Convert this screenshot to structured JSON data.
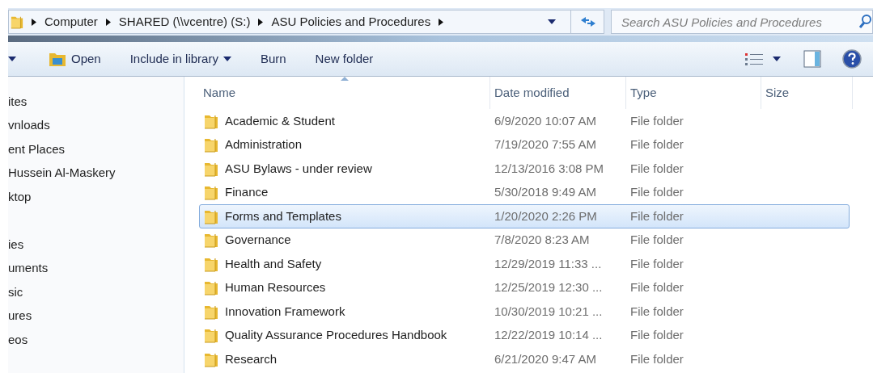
{
  "address_bar": {
    "segments": [
      "Computer",
      "SHARED (\\\\vcentre) (S:)",
      "ASU Policies and Procedures"
    ]
  },
  "search": {
    "placeholder": "Search ASU Policies and Procedures"
  },
  "toolbar": {
    "buttons": [
      {
        "label": "Open",
        "kind": "open"
      },
      {
        "label": "Include in library",
        "kind": "dropdown"
      },
      {
        "label": "Burn",
        "kind": "plain"
      },
      {
        "label": "New folder",
        "kind": "plain"
      }
    ]
  },
  "sidebar": {
    "groups": [
      {
        "items": [
          "ites",
          "vnloads",
          "ent Places",
          "Hussein Al-Maskery",
          "ktop"
        ]
      },
      {
        "items": [
          "ies",
          "uments",
          "sic",
          "ures",
          "eos"
        ]
      }
    ]
  },
  "table": {
    "columns": [
      {
        "label": "Name",
        "sorted": true
      },
      {
        "label": "Date modified",
        "sorted": false
      },
      {
        "label": "Type",
        "sorted": false
      },
      {
        "label": "Size",
        "sorted": false
      }
    ],
    "rows": [
      {
        "name": "Academic & Student",
        "date": "6/9/2020 10:07 AM",
        "type": "File folder",
        "selected": false
      },
      {
        "name": "Administration",
        "date": "7/19/2020 7:55 AM",
        "type": "File folder",
        "selected": false
      },
      {
        "name": "ASU Bylaws - under review",
        "date": "12/13/2016 3:08 PM",
        "type": "File folder",
        "selected": false
      },
      {
        "name": "Finance",
        "date": "5/30/2018 9:49 AM",
        "type": "File folder",
        "selected": false
      },
      {
        "name": "Forms and Templates",
        "date": "1/20/2020 2:26 PM",
        "type": "File folder",
        "selected": true
      },
      {
        "name": "Governance",
        "date": "7/8/2020 8:23 AM",
        "type": "File folder",
        "selected": false
      },
      {
        "name": "Health and Safety",
        "date": "12/29/2019 11:33 ...",
        "type": "File folder",
        "selected": false
      },
      {
        "name": "Human Resources",
        "date": "12/25/2019 12:30 ...",
        "type": "File folder",
        "selected": false
      },
      {
        "name": "Innovation Framework",
        "date": "10/30/2019 10:21 ...",
        "type": "File folder",
        "selected": false
      },
      {
        "name": "Quality Assurance Procedures Handbook",
        "date": "12/22/2019 10:14 ...",
        "type": "File folder",
        "selected": false
      },
      {
        "name": "Research",
        "date": "6/21/2020 9:47 AM",
        "type": "File folder",
        "selected": false
      }
    ]
  }
}
